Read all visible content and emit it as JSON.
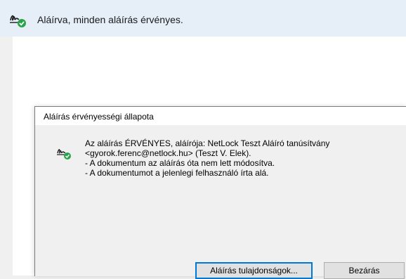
{
  "banner": {
    "icon": "signature-valid-icon",
    "text": "Aláírva, minden aláírás érvényes."
  },
  "dialog": {
    "title": "Aláírás érvényességi állapota",
    "status_icon": "signature-valid-icon",
    "message_lines": [
      "Az aláírás ÉRVÉNYES, aláírója: NetLock Teszt Aláíró tanúsítvány",
      "<gyorok.ferenc@netlock.hu> (Teszt V. Elek).",
      "- A dokumentum az aláírás óta nem lett módosítva.",
      "- A dokumentumot a jelenlegi felhasználó írta alá."
    ],
    "buttons": {
      "properties_label": "Aláírás tulajdonságok...",
      "close_label": "Bezárás"
    }
  },
  "colors": {
    "banner_bg": "#e6eef8",
    "valid_green": "#2aa34a",
    "button_focus": "#0078d7"
  }
}
